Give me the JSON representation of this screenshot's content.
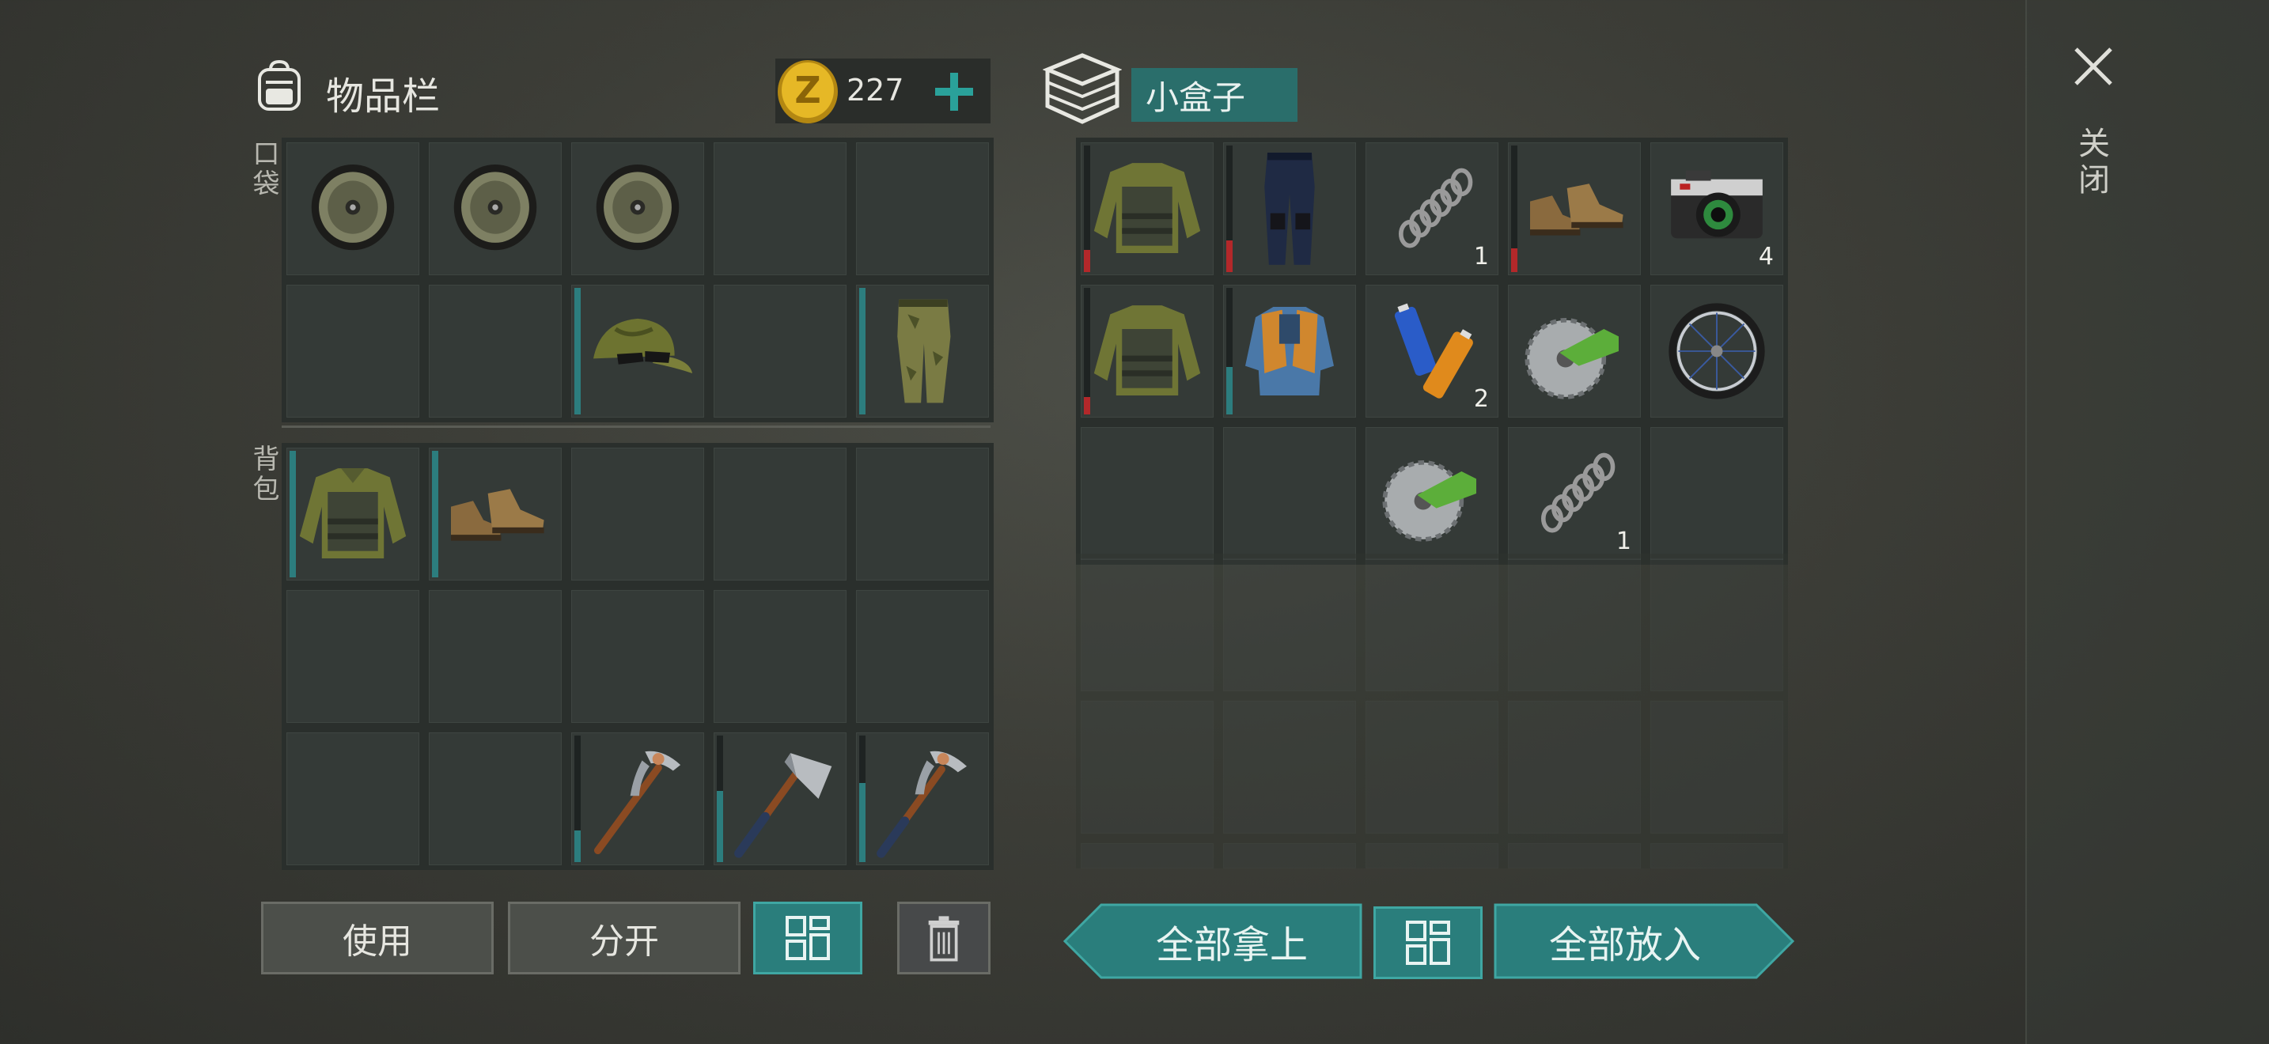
{
  "inventory": {
    "title": "物品栏",
    "icon": "backpack-icon",
    "coins": "227",
    "coin_icon": "z-coin-icon",
    "add_icon": "plus-icon",
    "pocket_label": "口袋",
    "backpack_label": "背包"
  },
  "container": {
    "title": "小盒子",
    "icon": "box-icon",
    "items": [
      {
        "name": "tactical-jacket",
        "qty": ""
      },
      {
        "name": "jeans",
        "qty": ""
      },
      {
        "name": "spring",
        "qty": "1"
      },
      {
        "name": "boots",
        "qty": ""
      },
      {
        "name": "camera",
        "qty": "4"
      },
      {
        "name": "tactical-jacket",
        "qty": ""
      },
      {
        "name": "bulletproof-vest",
        "qty": ""
      },
      {
        "name": "batteries",
        "qty": "2"
      },
      {
        "name": "saw-blade",
        "qty": ""
      },
      {
        "name": "bicycle-wheel",
        "qty": ""
      },
      {
        "name": "empty",
        "qty": ""
      },
      {
        "name": "empty",
        "qty": ""
      },
      {
        "name": "saw-blade",
        "qty": ""
      },
      {
        "name": "spring",
        "qty": "1"
      },
      {
        "name": "empty",
        "qty": ""
      }
    ]
  },
  "close": {
    "label": "关闭",
    "icon": "close-icon"
  },
  "buttons": {
    "use": "使用",
    "split": "分开",
    "sort_icon": "grid-sort-icon",
    "trash_icon": "trash-icon",
    "take_all": "全部拿上",
    "put_all": "全部放入"
  },
  "colors": {
    "accent": "#2a7e7c",
    "durability_good": "#2c7d7e",
    "durability_bad": "#b3282a"
  }
}
